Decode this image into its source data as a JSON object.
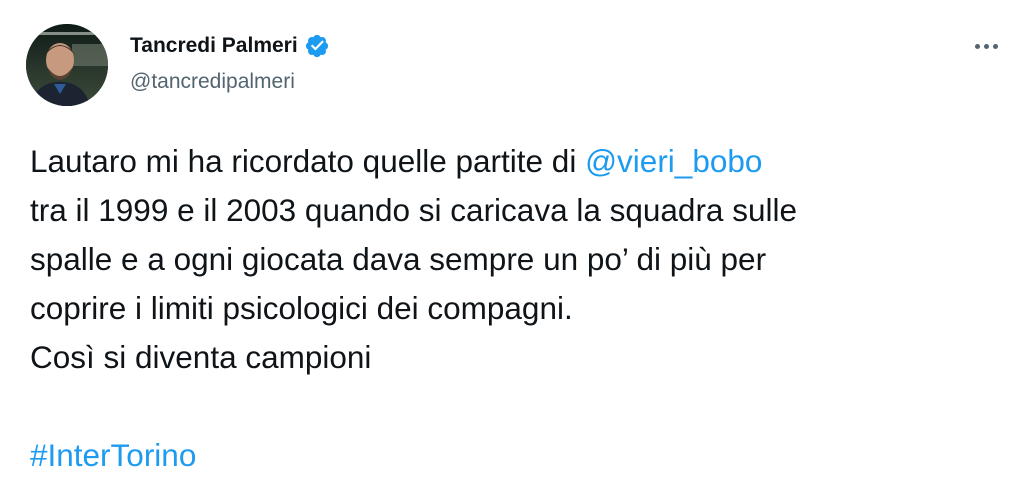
{
  "author": {
    "display_name": "Tancredi Palmeri",
    "handle": "@tancredipalmeri",
    "verified": true,
    "verified_color": "#1d9bf0"
  },
  "menu_icon": "more-horizontal-icon",
  "tweet": {
    "line1_text": "Lautaro mi ha ricordato quelle partite di ",
    "mention": "@vieri_bobo",
    "line2": "tra il 1999 e il 2003 quando si caricava la squadra sulle",
    "line3": "spalle e a ogni giocata dava sempre un po’ di più per",
    "line4": "coprire i limiti psicologici dei compagni.",
    "line5": "Così si diventa campioni",
    "hashtag": "#InterTorino"
  },
  "colors": {
    "text": "#0f1419",
    "secondary": "#536471",
    "link": "#1d9bf0"
  }
}
